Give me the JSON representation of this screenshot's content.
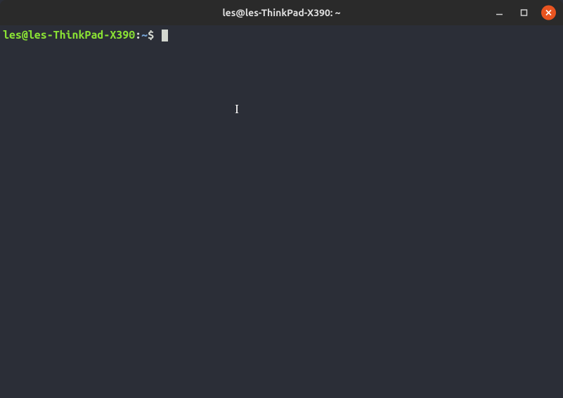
{
  "window": {
    "title": "les@les-ThinkPad-X390: ~"
  },
  "prompt": {
    "user_host": "les@les-ThinkPad-X390",
    "colon": ":",
    "path": "~",
    "symbol": "$ "
  },
  "icons": {
    "minimize": "minimize",
    "maximize": "maximize",
    "close": "close"
  },
  "colors": {
    "titlebar_bg": "#2a2a2a",
    "terminal_bg": "#2b2e37",
    "prompt_user": "#8ae234",
    "prompt_path": "#729fcf",
    "text": "#d3d7cf",
    "close_btn": "#e95420"
  }
}
